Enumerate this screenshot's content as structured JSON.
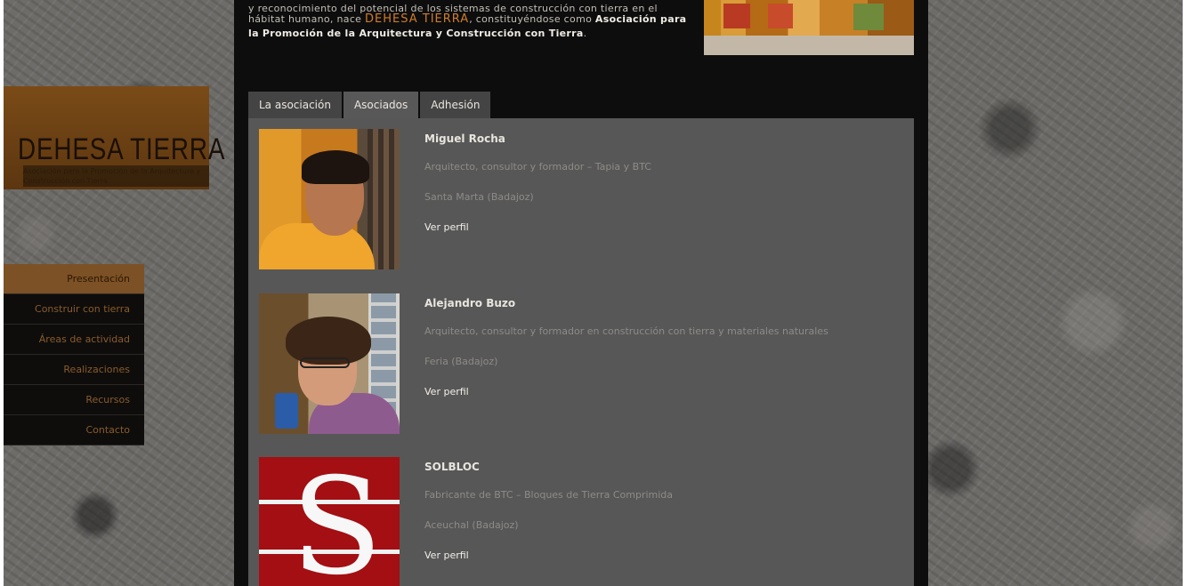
{
  "logo": {
    "title": "DEHESA TIERRA",
    "subtitle": "Asociación para la Promoción de la Arquitectura y Construcción con Tierra"
  },
  "nav": {
    "items": [
      {
        "label": "Presentación",
        "active": true
      },
      {
        "label": "Construir con tierra",
        "active": false
      },
      {
        "label": "Áreas de actividad",
        "active": false
      },
      {
        "label": "Realizaciones",
        "active": false
      },
      {
        "label": "Recursos",
        "active": false
      },
      {
        "label": "Contacto",
        "active": false
      }
    ]
  },
  "intro": {
    "line_cut": "y reconocimiento del potencial de los sistemas de construcción con tierra en el",
    "part1": "hábitat humano, nace",
    "brand": "DEHESA TIERRA",
    "part2": ", constituyéndose como",
    "bold": "Asociación para la Promoción de la Arquitectura y Construcción con Tierra",
    "end": "."
  },
  "tabs": [
    {
      "label": "La asociación",
      "active": false
    },
    {
      "label": "Asociados",
      "active": true
    },
    {
      "label": "Adhesión",
      "active": false
    }
  ],
  "members": [
    {
      "name": "Miguel Rocha",
      "role": "Arquitecto, consultor y formador – Tapia y BTC",
      "location": "Santa Marta (Badajoz)",
      "link": "Ver perfil"
    },
    {
      "name": "Alejandro Buzo",
      "role": "Arquitecto, consultor y formador en construcción con tierra y materiales naturales",
      "location": "Feria (Badajoz)",
      "link": "Ver perfil"
    },
    {
      "name": "SOLBLOC",
      "role": "Fabricante de BTC – Bloques de Tierra Comprimida",
      "location": "Aceuchal (Badajoz)",
      "link": "Ver perfil"
    }
  ],
  "colors": {
    "accent": "#d07d2a",
    "nav_active": "#7c5125",
    "panel": "#575757",
    "page": "#0d0d0d"
  }
}
